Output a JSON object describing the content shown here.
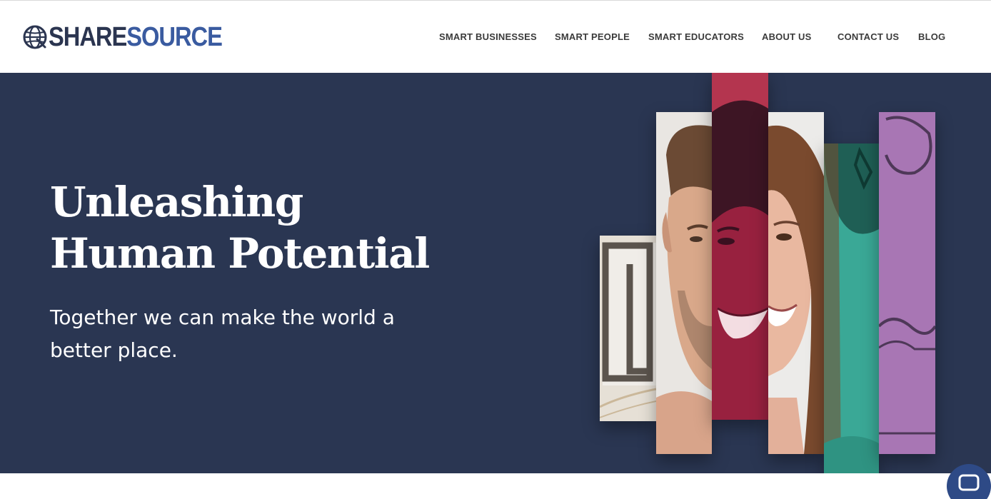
{
  "brand": {
    "logo_part_one": "SHARE",
    "logo_part_two": "SOURCE",
    "colors": {
      "dark": "#2b3550",
      "accent": "#3a5ba0"
    }
  },
  "nav": {
    "items": [
      {
        "label": "SMART BUSINESSES"
      },
      {
        "label": "SMART PEOPLE"
      },
      {
        "label": "SMART EDUCATORS"
      },
      {
        "label": "ABOUT US"
      },
      {
        "label": "CONTACT US"
      },
      {
        "label": "BLOG"
      }
    ]
  },
  "hero": {
    "title_line_1": "Unleashing",
    "title_line_2": "Human Potential",
    "subtitle": "Together we can make the world a better place.",
    "background_color": "#2a3652",
    "collage_icon": "portrait-strips-collage"
  },
  "chat": {
    "icon": "chat-icon",
    "color": "#2e4a86"
  }
}
